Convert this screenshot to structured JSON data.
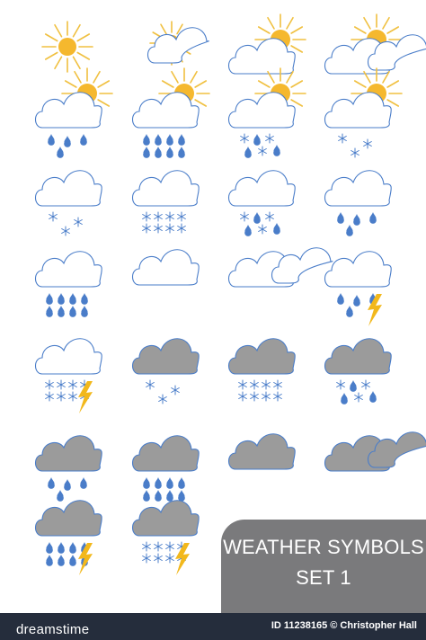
{
  "title": {
    "line1": "WEATHER SYMBOLS",
    "line2": "SET 1"
  },
  "footer": {
    "brand": "dreamstime",
    "credit": "ID 11238165 © Christopher Hall"
  },
  "watermark": "dreamstime",
  "colors": {
    "background": "#ffffff",
    "sun": "#f5b82e",
    "sun_rays": "#f0c040",
    "cloud_outline": "#4a7dc9",
    "cloud_fill_light": "#ffffff",
    "cloud_fill_dark": "#9b9b9b",
    "raindrop": "#4a7dc9",
    "snowflake": "#4a7dc9",
    "lightning": "#f2b81c",
    "title_panel": "#7a7a7c",
    "footer_bar": "#252d3c"
  },
  "symbols": [
    {
      "row": 1,
      "col": 1,
      "cloud": "none",
      "sun": "full",
      "precip": "none",
      "lightning": false
    },
    {
      "row": 1,
      "col": 2,
      "cloud": "small",
      "sun": "behind",
      "precip": "none",
      "lightning": false
    },
    {
      "row": 1,
      "col": 3,
      "cloud": "light",
      "sun": "behind",
      "precip": "none",
      "lightning": false
    },
    {
      "row": 1,
      "col": 4,
      "cloud": "light-double",
      "sun": "behind",
      "precip": "none",
      "lightning": false
    },
    {
      "row": 2,
      "col": 1,
      "cloud": "light",
      "sun": "behind",
      "precip": "light-rain",
      "lightning": false
    },
    {
      "row": 2,
      "col": 2,
      "cloud": "light",
      "sun": "behind",
      "precip": "heavy-rain",
      "lightning": false
    },
    {
      "row": 2,
      "col": 3,
      "cloud": "light",
      "sun": "behind",
      "precip": "sleet",
      "lightning": false
    },
    {
      "row": 2,
      "col": 4,
      "cloud": "light",
      "sun": "behind",
      "precip": "light-snow",
      "lightning": false
    },
    {
      "row": 3,
      "col": 1,
      "cloud": "light",
      "sun": "none",
      "precip": "light-snow",
      "lightning": false
    },
    {
      "row": 3,
      "col": 2,
      "cloud": "light",
      "sun": "none",
      "precip": "heavy-snow",
      "lightning": false
    },
    {
      "row": 3,
      "col": 3,
      "cloud": "light",
      "sun": "none",
      "precip": "sleet",
      "lightning": false
    },
    {
      "row": 3,
      "col": 4,
      "cloud": "light",
      "sun": "none",
      "precip": "light-rain",
      "lightning": false
    },
    {
      "row": 4,
      "col": 1,
      "cloud": "light",
      "sun": "none",
      "precip": "heavy-rain",
      "lightning": false
    },
    {
      "row": 4,
      "col": 2,
      "cloud": "light-flat",
      "sun": "none",
      "precip": "none",
      "lightning": false
    },
    {
      "row": 4,
      "col": 3,
      "cloud": "light-double",
      "sun": "none",
      "precip": "none",
      "lightning": false
    },
    {
      "row": 4,
      "col": 4,
      "cloud": "light",
      "sun": "none",
      "precip": "light-rain",
      "lightning": true
    },
    {
      "row": 5,
      "col": 1,
      "cloud": "light",
      "sun": "none",
      "precip": "heavy-snow",
      "lightning": true
    },
    {
      "row": 5,
      "col": 2,
      "cloud": "dark",
      "sun": "none",
      "precip": "light-snow",
      "lightning": false
    },
    {
      "row": 5,
      "col": 3,
      "cloud": "dark",
      "sun": "none",
      "precip": "heavy-snow",
      "lightning": false
    },
    {
      "row": 5,
      "col": 4,
      "cloud": "dark",
      "sun": "none",
      "precip": "sleet",
      "lightning": false
    },
    {
      "row": 6,
      "col": 1,
      "cloud": "dark",
      "sun": "none",
      "precip": "light-rain",
      "lightning": false
    },
    {
      "row": 6,
      "col": 2,
      "cloud": "dark",
      "sun": "none",
      "precip": "heavy-rain",
      "lightning": false
    },
    {
      "row": 6,
      "col": 3,
      "cloud": "dark-flat",
      "sun": "none",
      "precip": "none",
      "lightning": false
    },
    {
      "row": 6,
      "col": 4,
      "cloud": "dark-double",
      "sun": "none",
      "precip": "none",
      "lightning": false
    },
    {
      "row": 7,
      "col": 1,
      "cloud": "dark",
      "sun": "none",
      "precip": "heavy-rain",
      "lightning": true
    },
    {
      "row": 7,
      "col": 2,
      "cloud": "dark",
      "sun": "none",
      "precip": "heavy-snow",
      "lightning": true
    }
  ]
}
